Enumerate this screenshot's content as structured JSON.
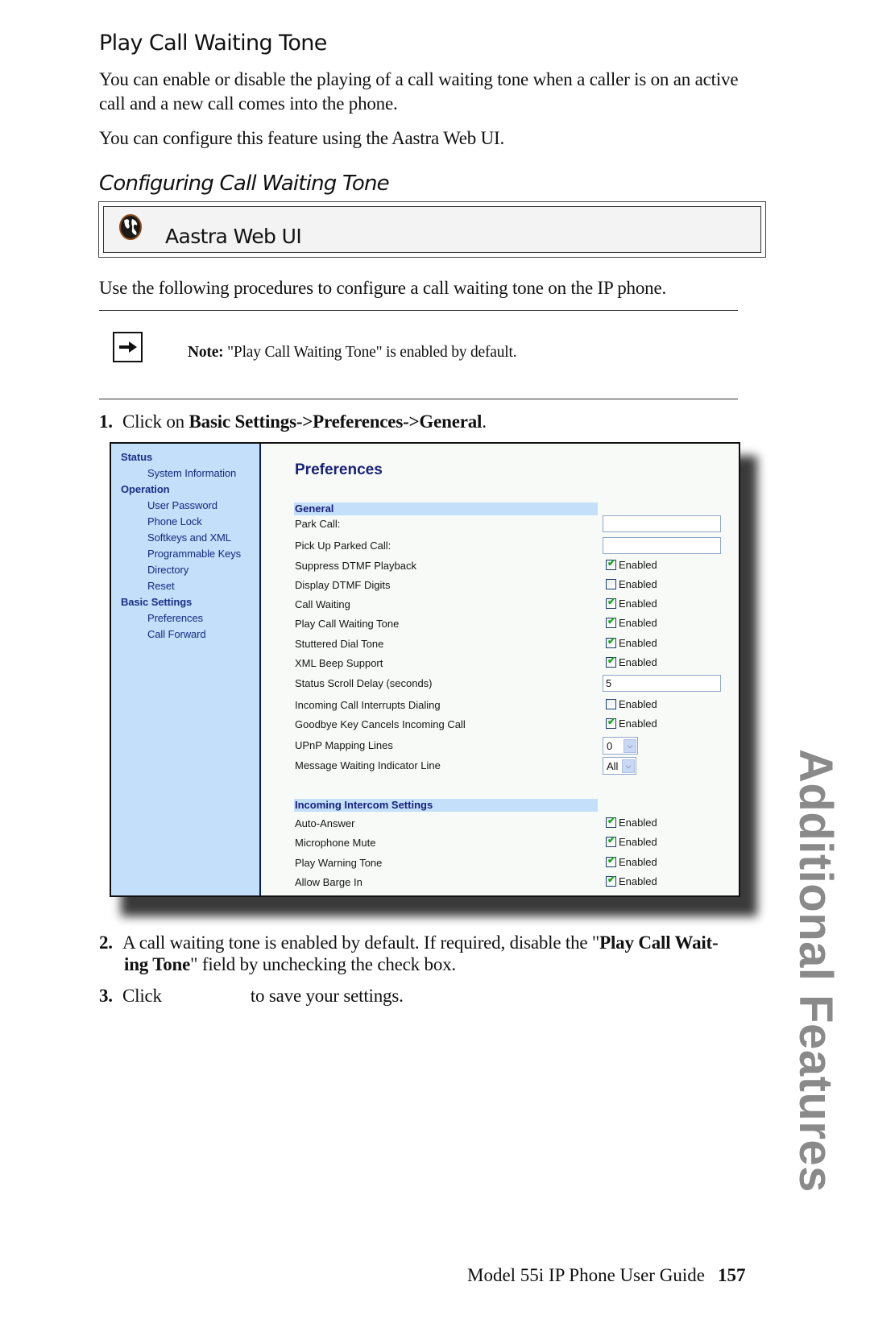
{
  "title": "Play Call Waiting Tone",
  "intro": [
    "You can enable or disable the playing of a call waiting tone when a caller is on an active call and a new call comes into the phone.",
    "You can configure this feature using the Aastra Web UI."
  ],
  "subheading": "Configuring Call Waiting Tone",
  "method_box": {
    "icon": "globe-icon",
    "label": "Aastra Web UI"
  },
  "procedure_intro": "Use the following procedures to configure a call waiting tone on the IP phone.",
  "note": {
    "icon": "arrow-right-icon",
    "label": "Note:",
    "text": "\"Play Call Waiting Tone\" is enabled by default."
  },
  "steps": [
    {
      "num": "1.",
      "pre": "Click on ",
      "bold": "Basic Settings->Preferences->General",
      "post": "."
    },
    {
      "num": "2.",
      "pre": "A call waiting tone is enabled by default. If required, disable the \"",
      "bold": "Play Call Wait-",
      "cont_bold": "ing Tone",
      "post": "\" field by unchecking the check box."
    },
    {
      "num": "3.",
      "pre": "Click",
      "gap": "",
      "post": "to save your settings."
    }
  ],
  "screenshot": {
    "sidebar": [
      {
        "label": "Status",
        "type": "section"
      },
      {
        "label": "System Information",
        "type": "item"
      },
      {
        "label": "Operation",
        "type": "section"
      },
      {
        "label": "User Password",
        "type": "item"
      },
      {
        "label": "Phone Lock",
        "type": "item"
      },
      {
        "label": "Softkeys and XML",
        "type": "item"
      },
      {
        "label": "Programmable Keys",
        "type": "item"
      },
      {
        "label": "Directory",
        "type": "item"
      },
      {
        "label": "Reset",
        "type": "item"
      },
      {
        "label": "Basic Settings",
        "type": "section"
      },
      {
        "label": "Preferences",
        "type": "item"
      },
      {
        "label": "Call Forward",
        "type": "item"
      }
    ],
    "page_title": "Preferences",
    "groups": [
      {
        "header": "General",
        "rows": [
          {
            "label": "Park Call:",
            "control": "text",
            "value": ""
          },
          {
            "label": "Pick Up Parked Call:",
            "control": "text",
            "value": ""
          },
          {
            "label": "Suppress DTMF Playback",
            "control": "checkbox",
            "checked": true,
            "text": "Enabled"
          },
          {
            "label": "Display DTMF Digits",
            "control": "checkbox",
            "checked": false,
            "text": "Enabled"
          },
          {
            "label": "Call Waiting",
            "control": "checkbox",
            "checked": true,
            "text": "Enabled"
          },
          {
            "label": "Play Call Waiting Tone",
            "control": "checkbox",
            "checked": true,
            "text": "Enabled"
          },
          {
            "label": "Stuttered Dial Tone",
            "control": "checkbox",
            "checked": true,
            "text": "Enabled"
          },
          {
            "label": "XML Beep Support",
            "control": "checkbox",
            "checked": true,
            "text": "Enabled"
          },
          {
            "label": "Status Scroll Delay (seconds)",
            "control": "text",
            "value": "5"
          },
          {
            "label": "Incoming Call Interrupts Dialing",
            "control": "checkbox",
            "checked": false,
            "text": "Enabled"
          },
          {
            "label": "Goodbye Key Cancels Incoming Call",
            "control": "checkbox",
            "checked": true,
            "text": "Enabled"
          },
          {
            "label": "UPnP Mapping Lines",
            "control": "select",
            "value": "0"
          },
          {
            "label": "Message Waiting Indicator Line",
            "control": "select",
            "value": "All"
          }
        ]
      },
      {
        "header": "Incoming Intercom Settings",
        "rows": [
          {
            "label": "Auto-Answer",
            "control": "checkbox",
            "checked": true,
            "text": "Enabled"
          },
          {
            "label": "Microphone Mute",
            "control": "checkbox",
            "checked": true,
            "text": "Enabled"
          },
          {
            "label": "Play Warning Tone",
            "control": "checkbox",
            "checked": true,
            "text": "Enabled"
          },
          {
            "label": "Allow Barge In",
            "control": "checkbox",
            "checked": true,
            "text": "Enabled"
          }
        ]
      }
    ],
    "colors": {
      "sidebar_bg": "#c3dff9",
      "nav_text": "#142a83",
      "check": "#1aa51a"
    }
  },
  "side_tab": "Additional Features",
  "footer": {
    "title": "Model 55i IP Phone User Guide",
    "page": "157"
  }
}
